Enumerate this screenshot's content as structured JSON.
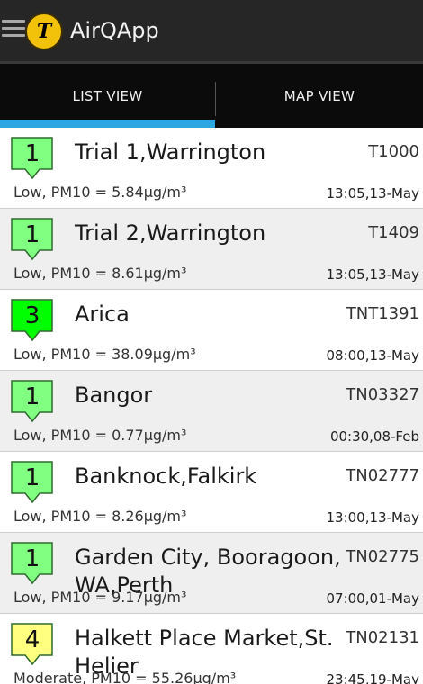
{
  "app": {
    "title": "AirQApp",
    "logo_text": "T",
    "menu_icon": "hamburger-menu-icon"
  },
  "tabs": [
    {
      "label": "LIST VIEW",
      "selected": true
    },
    {
      "label": "MAP VIEW",
      "selected": false
    }
  ],
  "colors": {
    "tab_indicator": "#2ea7e0",
    "band_1": "#80ff80",
    "band_3": "#00ff00",
    "band_4": "#ffff80"
  },
  "stations": [
    {
      "band": "1",
      "name": "Trial 1,Warrington",
      "code": "T1000",
      "reading": "Low, PM10 = 5.84µg/m³",
      "time": "13:05,13-May",
      "color": "#80ff80"
    },
    {
      "band": "1",
      "name": "Trial 2,Warrington",
      "code": "T1409",
      "reading": "Low, PM10 = 8.61µg/m³",
      "time": "13:05,13-May",
      "color": "#80ff80"
    },
    {
      "band": "3",
      "name": "Arica",
      "code": "TNT1391",
      "reading": "Low, PM10 = 38.09µg/m³",
      "time": "08:00,13-May",
      "color": "#00ff00"
    },
    {
      "band": "1",
      "name": "Bangor",
      "code": "TN03327",
      "reading": "Low, PM10 = 0.77µg/m³",
      "time": "00:30,08-Feb",
      "color": "#80ff80"
    },
    {
      "band": "1",
      "name": "Banknock,Falkirk",
      "code": "TN02777",
      "reading": "Low, PM10 = 8.26µg/m³",
      "time": "13:00,13-May",
      "color": "#80ff80"
    },
    {
      "band": "1",
      "name": "Garden City, Booragoon, WA,Perth",
      "code": "TN02775",
      "reading": "Low, PM10 = 9.17µg/m³",
      "time": "07:00,01-May",
      "color": "#80ff80"
    },
    {
      "band": "4",
      "name": "Halkett Place Market,St. Helier",
      "code": "TN02131",
      "reading": "Moderate, PM10 = 55.26µg/m³",
      "time": "23:45,19-May",
      "color": "#ffff80"
    }
  ]
}
